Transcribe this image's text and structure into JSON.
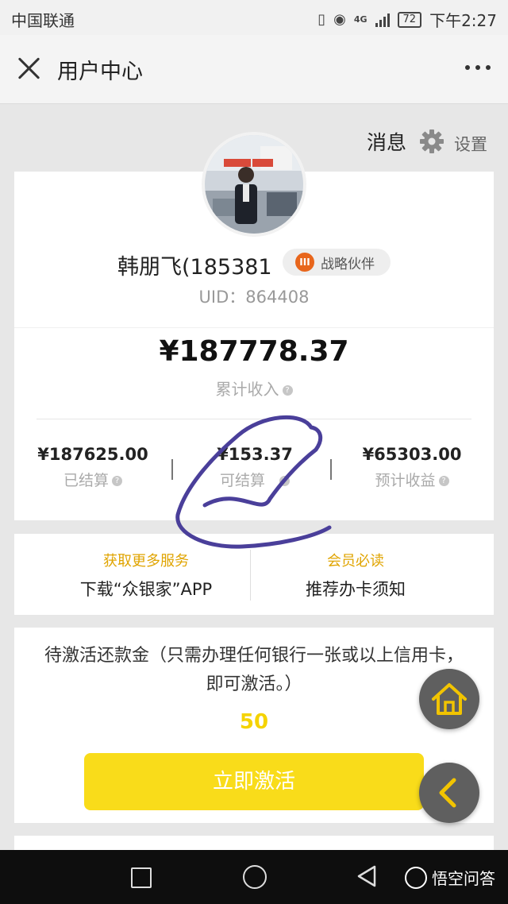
{
  "status_bar": {
    "carrier": "中国联通",
    "network": "4G",
    "battery": "72",
    "time": "下午2:27"
  },
  "nav": {
    "title": "用户中心"
  },
  "top_actions": {
    "messages": "消息",
    "settings": "设置"
  },
  "profile": {
    "name": "韩朋飞(185381",
    "badge": "战略伙伴",
    "badge_icon": "III",
    "uid": "UID：864408"
  },
  "income": {
    "total": "¥187778.37",
    "total_label": "累计收入",
    "help_mark": "?",
    "stats": [
      {
        "value": "¥187625.00",
        "label": "已结算"
      },
      {
        "value": "¥153.37",
        "label": "可结算"
      },
      {
        "value": "¥65303.00",
        "label": "预计收益"
      }
    ]
  },
  "services": [
    {
      "title": "获取更多服务",
      "subtitle": "下载“众银家”APP"
    },
    {
      "title": "会员必读",
      "subtitle": "推荐办卡须知"
    }
  ],
  "activation": {
    "text": "待激活还款金（只需办理任何银行一张或以上信用卡，即可激活。）",
    "amount": "50",
    "button": "立即激活"
  },
  "watermark": {
    "brand": "悟空问答"
  },
  "colors": {
    "accent_yellow": "#f9dc1a",
    "label_gold": "#e0a400",
    "badge_orange": "#e8661c",
    "ink": "#4a3f9a"
  }
}
